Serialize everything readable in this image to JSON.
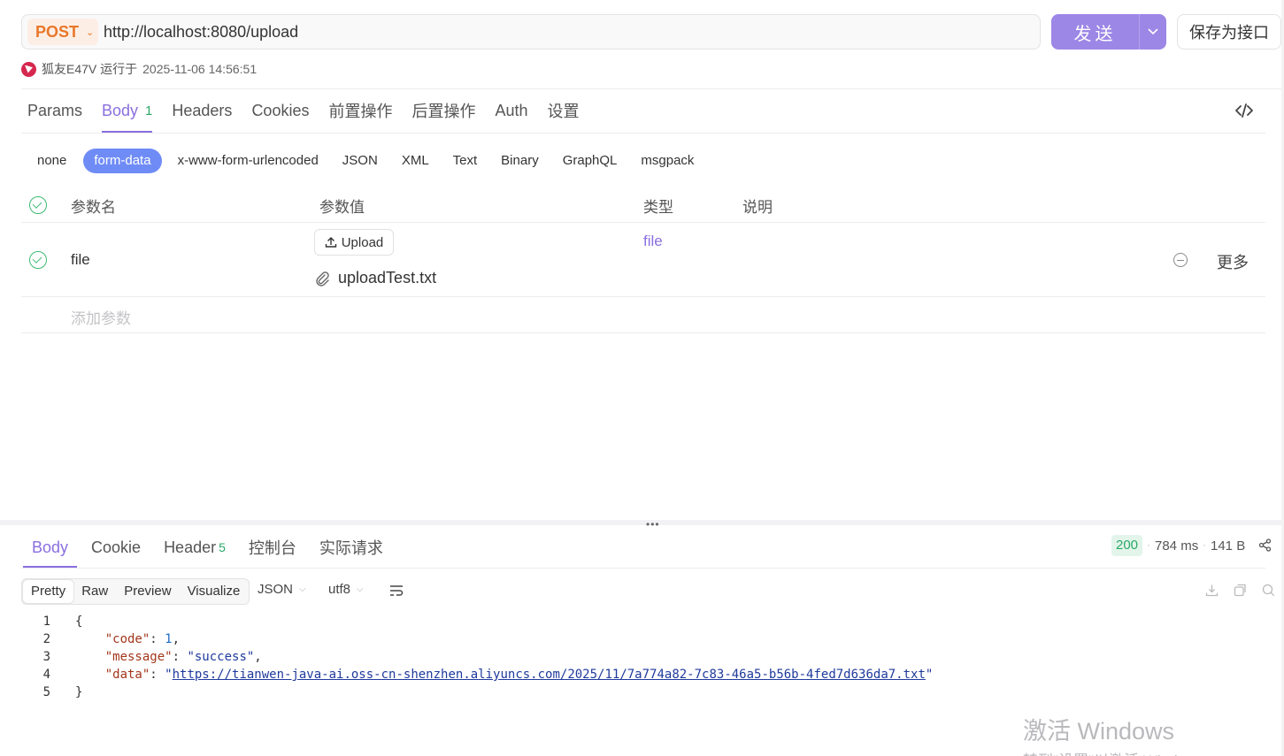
{
  "request": {
    "method": "POST",
    "url": "http://localhost:8080/upload",
    "send_label": "发送",
    "save_label": "保存为接口"
  },
  "run_info": {
    "runner": "狐友E47V 运行于",
    "timestamp": "2025-11-06 14:56:51"
  },
  "request_tabs": [
    {
      "label": "Params"
    },
    {
      "label": "Body",
      "count": "1"
    },
    {
      "label": "Headers"
    },
    {
      "label": "Cookies"
    },
    {
      "label": "前置操作"
    },
    {
      "label": "后置操作"
    },
    {
      "label": "Auth"
    },
    {
      "label": "设置"
    }
  ],
  "body_types": [
    "none",
    "form-data",
    "x-www-form-urlencoded",
    "JSON",
    "XML",
    "Text",
    "Binary",
    "GraphQL",
    "msgpack"
  ],
  "params_table": {
    "headers": {
      "name": "参数名",
      "value": "参数值",
      "type": "类型",
      "desc": "说明"
    },
    "rows": [
      {
        "name": "file",
        "upload_label": "Upload",
        "file_name": "uploadTest.txt",
        "type": "file",
        "more": "更多"
      }
    ],
    "add_placeholder": "添加参数"
  },
  "response_tabs": [
    {
      "label": "Body"
    },
    {
      "label": "Cookie"
    },
    {
      "label": "Header",
      "count": "5"
    },
    {
      "label": "控制台"
    },
    {
      "label": "实际请求"
    }
  ],
  "response_meta": {
    "status": "200",
    "time": "784 ms",
    "size": "141 B"
  },
  "view_modes": [
    "Pretty",
    "Raw",
    "Preview",
    "Visualize"
  ],
  "format": "JSON",
  "encoding": "utf8",
  "response_body": {
    "line_numbers": [
      "1",
      "2",
      "3",
      "4",
      "5"
    ],
    "open_brace": "{",
    "close_brace": "}",
    "code_key": "\"code\"",
    "code_value": "1",
    "message_key": "\"message\"",
    "message_value": "\"success\"",
    "data_key": "\"data\"",
    "data_url": "https://tianwen-java-ai.oss-cn-shenzhen.aliyuncs.com/2025/11/7a774a82-7c83-46a5-b56b-4fed7d636da7.txt"
  },
  "watermark": {
    "line1": "激活 Windows",
    "line2": "转到\"设置\"以激活 Windows。"
  },
  "colors": {
    "accent": "#8a6fdf",
    "send_button": "#9c86e6",
    "method": "#e8772a",
    "active_body_type": "#6f8cf6",
    "success": "#2aa868"
  },
  "icons": [
    "chevron-down-icon",
    "code-icon",
    "check-circle-icon",
    "upload-icon",
    "paperclip-icon",
    "minus-circle-icon",
    "share-icon",
    "download-icon",
    "copy-icon",
    "search-icon",
    "wrap-lines-icon",
    "logo-icon"
  ]
}
